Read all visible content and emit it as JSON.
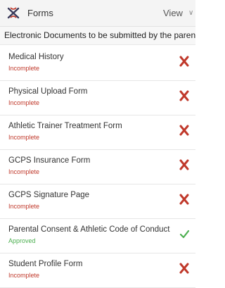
{
  "header": {
    "title": "Forms",
    "view_label": "View",
    "chevron_glyph": "∨"
  },
  "subheader": {
    "text": "Electronic Documents to be submitted by the parent"
  },
  "colors": {
    "incomplete": "#c0392b",
    "approved": "#4caf50"
  },
  "forms": [
    {
      "name": "Medical History",
      "status": "Incomplete",
      "state": "incomplete",
      "icon": "x-icon"
    },
    {
      "name": "Physical Upload Form",
      "status": "Incomplete",
      "state": "incomplete",
      "icon": "x-icon"
    },
    {
      "name": "Athletic Trainer Treatment Form",
      "status": "Incomplete",
      "state": "incomplete",
      "icon": "x-icon"
    },
    {
      "name": "GCPS Insurance Form",
      "status": "Incomplete",
      "state": "incomplete",
      "icon": "x-icon"
    },
    {
      "name": "GCPS Signature Page",
      "status": "Incomplete",
      "state": "incomplete",
      "icon": "x-icon"
    },
    {
      "name": "Parental Consent & Athletic Code of Conduct",
      "status": "Approved",
      "state": "approved",
      "icon": "check-icon"
    },
    {
      "name": "Student Profile Form",
      "status": "Incomplete",
      "state": "incomplete",
      "icon": "x-icon"
    }
  ]
}
